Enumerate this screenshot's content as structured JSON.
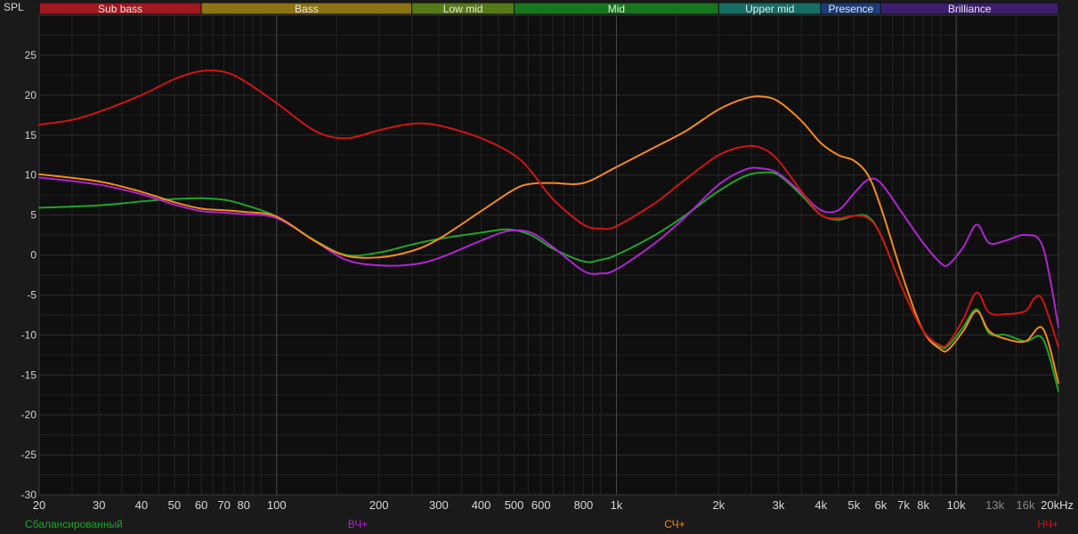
{
  "chart_data": {
    "type": "line",
    "ylabel": "SPL",
    "x_scale": "log",
    "xlim": [
      20,
      20000
    ],
    "ylim": [
      -30,
      30
    ],
    "grid": true,
    "y_ticks": [
      25,
      20,
      15,
      10,
      5,
      0,
      -5,
      -10,
      -15,
      -20,
      -25,
      -30
    ],
    "x_ticks": [
      {
        "value": 20,
        "label": "20"
      },
      {
        "value": 30,
        "label": "30"
      },
      {
        "value": 40,
        "label": "40"
      },
      {
        "value": 50,
        "label": "50"
      },
      {
        "value": 60,
        "label": "60"
      },
      {
        "value": 70,
        "label": "70"
      },
      {
        "value": 80,
        "label": "80"
      },
      {
        "value": 100,
        "label": "100"
      },
      {
        "value": 200,
        "label": "200"
      },
      {
        "value": 300,
        "label": "300"
      },
      {
        "value": 400,
        "label": "400"
      },
      {
        "value": 500,
        "label": "500"
      },
      {
        "value": 600,
        "label": "600"
      },
      {
        "value": 800,
        "label": "800"
      },
      {
        "value": 1000,
        "label": "1k"
      },
      {
        "value": 2000,
        "label": "2k"
      },
      {
        "value": 3000,
        "label": "3k"
      },
      {
        "value": 4000,
        "label": "4k"
      },
      {
        "value": 5000,
        "label": "5k"
      },
      {
        "value": 6000,
        "label": "6k"
      },
      {
        "value": 7000,
        "label": "7k"
      },
      {
        "value": 8000,
        "label": "8k"
      },
      {
        "value": 10000,
        "label": "10k"
      },
      {
        "value": 13000,
        "label": "13k",
        "dim": true
      },
      {
        "value": 16000,
        "label": "16k",
        "dim": true
      },
      {
        "value": 20000,
        "label": "20kHz"
      }
    ],
    "bands": [
      {
        "label": "Sub bass",
        "from": 20,
        "to": 60,
        "color": "#a01820"
      },
      {
        "label": "Bass",
        "from": 60,
        "to": 250,
        "color": "#8c7414"
      },
      {
        "label": "Low mid",
        "from": 250,
        "to": 500,
        "color": "#577a18"
      },
      {
        "label": "Mid",
        "from": 500,
        "to": 2000,
        "color": "#18761f"
      },
      {
        "label": "Upper mid",
        "from": 2000,
        "to": 4000,
        "color": "#176c66"
      },
      {
        "label": "Presence",
        "from": 4000,
        "to": 6000,
        "color": "#1d3c78"
      },
      {
        "label": "Brilliance",
        "from": 6000,
        "to": 20000,
        "color": "#3e1d6e"
      }
    ],
    "series": [
      {
        "name": "Сбалансированный",
        "color": "#1fa32a",
        "x": [
          20,
          30,
          40,
          50,
          60,
          70,
          80,
          100,
          130,
          160,
          200,
          250,
          300,
          400,
          480,
          560,
          650,
          800,
          900,
          1000,
          1300,
          1600,
          2000,
          2400,
          2700,
          3000,
          3500,
          4000,
          4500,
          5000,
          5500,
          6000,
          7000,
          8000,
          9000,
          9500,
          10500,
          11500,
          12500,
          14000,
          16000,
          18000,
          20000
        ],
        "y": [
          5.9,
          6.2,
          6.7,
          7.0,
          7.1,
          6.9,
          6.3,
          4.8,
          1.8,
          0.0,
          0.3,
          1.3,
          2.0,
          2.8,
          3.2,
          2.5,
          0.8,
          -0.8,
          -0.6,
          0.0,
          2.5,
          5.0,
          8.0,
          9.9,
          10.3,
          10.0,
          7.5,
          5.0,
          4.4,
          4.9,
          4.8,
          2.5,
          -4.5,
          -9.5,
          -11.5,
          -11.3,
          -9.0,
          -6.8,
          -9.8,
          -10.0,
          -10.8,
          -10.5,
          -17.0
        ]
      },
      {
        "name": "ВЧ+",
        "color": "#b025d0",
        "x": [
          20,
          30,
          40,
          50,
          60,
          70,
          80,
          100,
          130,
          160,
          200,
          250,
          300,
          400,
          480,
          560,
          650,
          800,
          900,
          1000,
          1300,
          1600,
          2000,
          2400,
          2700,
          3000,
          3500,
          4000,
          4500,
          5000,
          5500,
          6000,
          7000,
          8000,
          9000,
          9500,
          10500,
          11500,
          12500,
          14000,
          16000,
          18000,
          20000
        ],
        "y": [
          9.7,
          8.8,
          7.6,
          6.3,
          5.5,
          5.3,
          5.1,
          4.6,
          1.7,
          -0.6,
          -1.3,
          -1.2,
          -0.4,
          1.8,
          3.0,
          2.8,
          1.0,
          -2.0,
          -2.3,
          -1.8,
          1.5,
          4.8,
          8.8,
          10.7,
          10.8,
          10.2,
          7.8,
          5.6,
          5.6,
          7.7,
          9.4,
          9.0,
          5.0,
          1.5,
          -1.0,
          -1.2,
          1.0,
          3.8,
          1.5,
          1.8,
          2.5,
          1.0,
          -9.0
        ]
      },
      {
        "name": "СЧ+",
        "color": "#f58a1f",
        "x": [
          20,
          30,
          40,
          50,
          60,
          70,
          80,
          100,
          130,
          160,
          200,
          250,
          300,
          400,
          500,
          560,
          650,
          800,
          1000,
          1300,
          1600,
          2000,
          2400,
          2700,
          3000,
          3500,
          4000,
          4500,
          5000,
          5500,
          6000,
          7000,
          8000,
          9000,
          9500,
          10500,
          11500,
          12500,
          14000,
          16000,
          18000,
          20000
        ],
        "y": [
          10.1,
          9.2,
          7.9,
          6.6,
          5.8,
          5.6,
          5.4,
          4.8,
          1.7,
          -0.1,
          -0.3,
          0.5,
          2.0,
          5.5,
          8.2,
          8.9,
          9.0,
          9.0,
          11.0,
          13.5,
          15.5,
          18.2,
          19.6,
          19.8,
          19.2,
          16.8,
          14.0,
          12.5,
          11.8,
          10.0,
          6.0,
          -3.0,
          -9.5,
          -11.8,
          -11.8,
          -9.5,
          -7.0,
          -9.5,
          -10.5,
          -10.8,
          -9.2,
          -16.0
        ]
      },
      {
        "name": "НЧ+",
        "color": "#d01414",
        "x": [
          20,
          25,
          30,
          40,
          50,
          60,
          70,
          80,
          100,
          130,
          160,
          200,
          250,
          300,
          400,
          500,
          560,
          650,
          800,
          900,
          1000,
          1300,
          1600,
          2000,
          2400,
          2700,
          3000,
          3500,
          4000,
          4500,
          5000,
          5500,
          6000,
          7000,
          8000,
          9000,
          9500,
          10500,
          11500,
          12500,
          14000,
          16000,
          17000,
          18000,
          20000
        ],
        "y": [
          16.3,
          16.9,
          17.9,
          20.0,
          22.0,
          23.0,
          22.9,
          21.8,
          19.0,
          15.5,
          14.6,
          15.6,
          16.4,
          16.2,
          14.6,
          12.5,
          10.5,
          7.0,
          3.8,
          3.3,
          3.6,
          6.5,
          9.5,
          12.5,
          13.6,
          13.3,
          11.8,
          8.0,
          5.0,
          4.6,
          4.9,
          4.6,
          2.5,
          -4.5,
          -9.5,
          -11.3,
          -11.0,
          -8.0,
          -4.7,
          -7.2,
          -7.4,
          -7.0,
          -5.4,
          -5.7,
          -11.5
        ]
      }
    ]
  }
}
